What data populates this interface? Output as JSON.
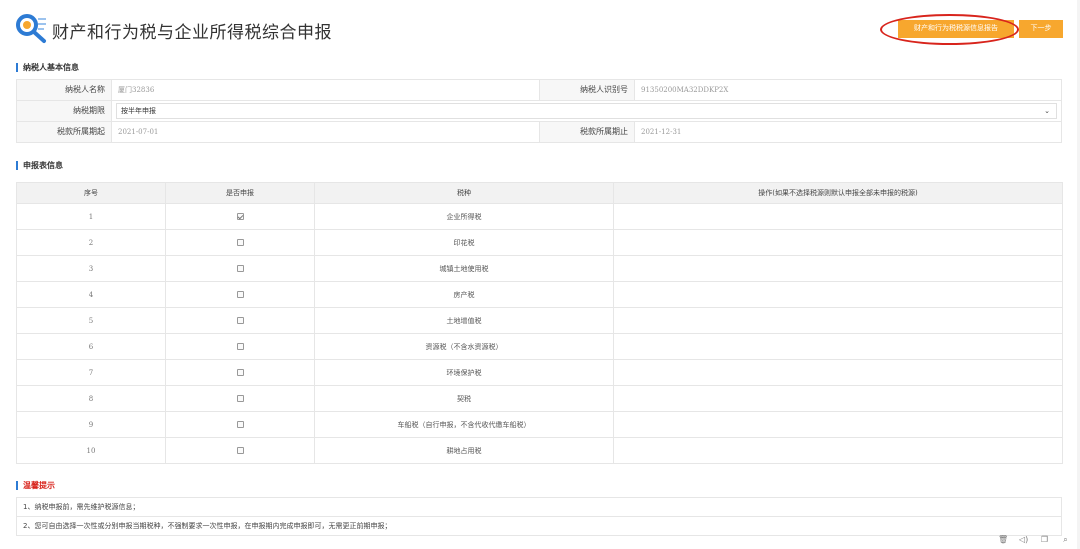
{
  "header": {
    "title": "财产和行为税与企业所得税综合申报",
    "report_button": "财产和行为税税源信息报告",
    "next_button": "下一步"
  },
  "taxpayer_section": {
    "title": "纳税人基本信息",
    "name_label": "纳税人名称",
    "name_value": "厦门32836",
    "id_label": "纳税人识别号",
    "id_value": "91350200MA32DDKP2X",
    "period_label": "纳税期限",
    "period_value": "按半年申报",
    "start_label": "税款所属期起",
    "start_value": "2021-07-01",
    "end_label": "税款所属期止",
    "end_value": "2021-12-31"
  },
  "declaration_section": {
    "title": "申报表信息",
    "columns": [
      "序号",
      "是否申报",
      "税种",
      "操作(如果不选择税源则默认申报全部未申报的税源)"
    ],
    "rows": [
      {
        "no": "1",
        "checked": true,
        "tax": "企业所得税"
      },
      {
        "no": "2",
        "checked": false,
        "tax": "印花税"
      },
      {
        "no": "3",
        "checked": false,
        "tax": "城镇土地使用税"
      },
      {
        "no": "4",
        "checked": false,
        "tax": "房产税"
      },
      {
        "no": "5",
        "checked": false,
        "tax": "土地增值税"
      },
      {
        "no": "6",
        "checked": false,
        "tax": "资源税（不含水资源税）"
      },
      {
        "no": "7",
        "checked": false,
        "tax": "环境保护税"
      },
      {
        "no": "8",
        "checked": false,
        "tax": "契税"
      },
      {
        "no": "9",
        "checked": false,
        "tax": "车船税（自行申报，不含代收代缴车船税）"
      },
      {
        "no": "10",
        "checked": false,
        "tax": "耕地占用税"
      }
    ]
  },
  "tips_section": {
    "title": "温馨提示",
    "items": [
      "1、纳税申报前，需先维护税源信息；",
      "2、您可自由选择一次性或分别申报当期税种，不强制要求一次性申报，在申报期内完成申报即可，无需更正前期申报；"
    ]
  },
  "colors": {
    "accent_orange": "#f7a72e",
    "highlight_red": "#d8241c",
    "section_blue": "#2d7bd4"
  },
  "icons": [
    "search-logo-icon",
    "chevron-down-icon",
    "trash-icon",
    "sound-icon",
    "window-icon",
    "search-icon"
  ]
}
